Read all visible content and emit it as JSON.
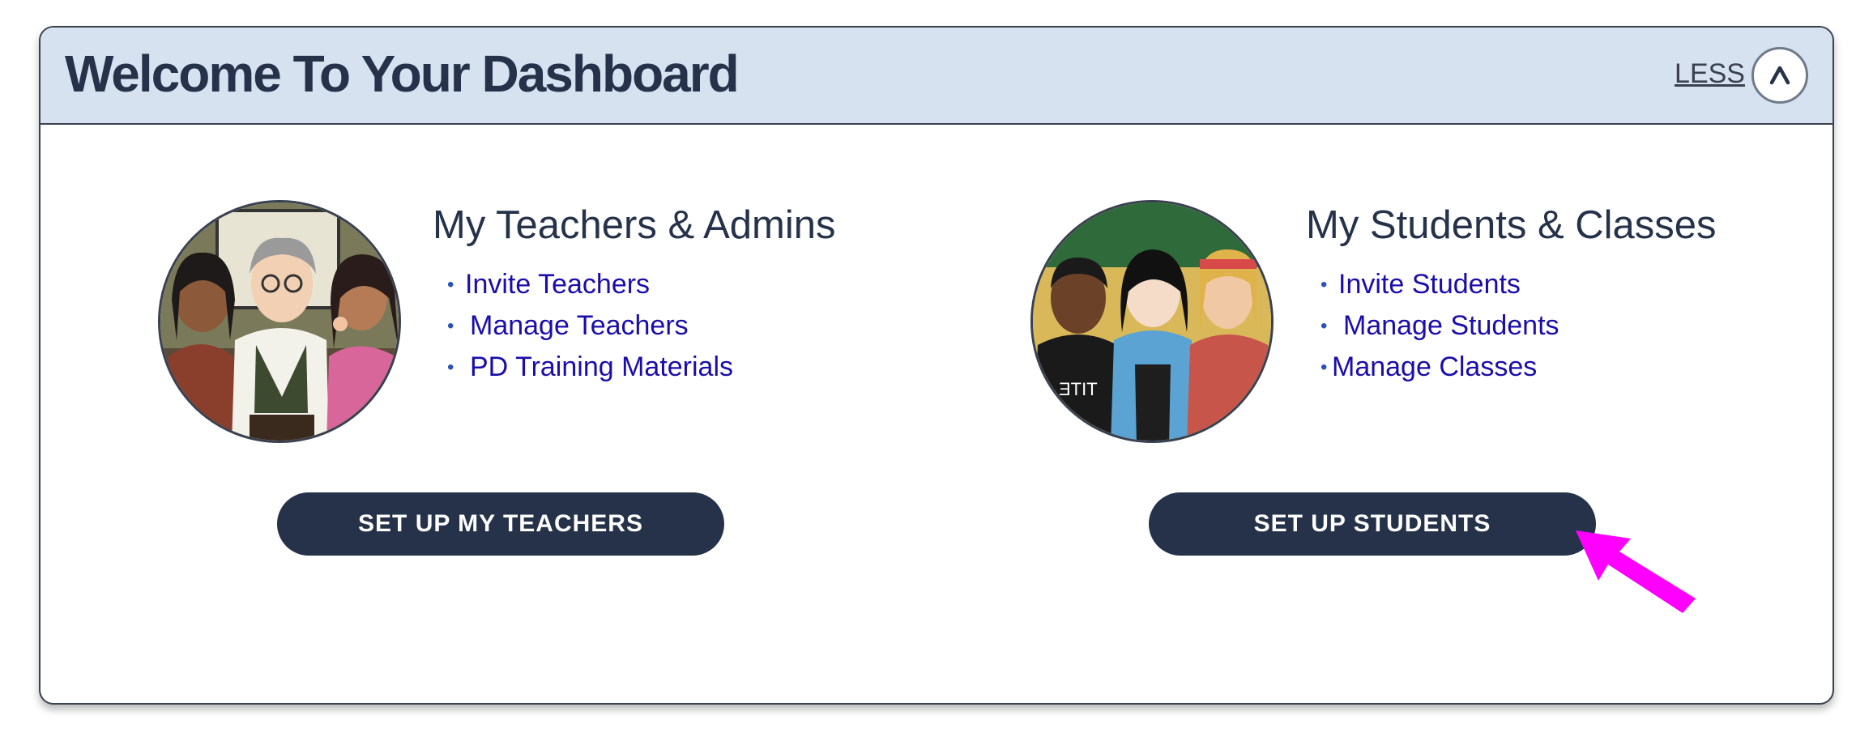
{
  "dashboard": {
    "title": "Welcome To Your Dashboard",
    "collapse_label": "LESS",
    "collapse_icon": "chevron-up-icon"
  },
  "teachers_section": {
    "title": "My Teachers & Admins",
    "links": [
      "Invite Teachers",
      "Manage Teachers",
      "PD Training Materials"
    ],
    "button_label": "SET UP MY TEACHERS",
    "illustration": "teachers-admins-illustration"
  },
  "students_section": {
    "title": "My Students & Classes",
    "links": [
      "Invite Students",
      "Manage Students",
      "Manage Classes"
    ],
    "button_label": "SET UP STUDENTS",
    "illustration": "students-classes-illustration"
  },
  "annotation": {
    "arrow_color": "#ff00ff",
    "icon": "pointer-arrow-icon"
  },
  "colors": {
    "header_bg": "#d7e2f1",
    "button_bg": "#25324a",
    "link": "#1a0dab",
    "title_text": "#25324a"
  }
}
